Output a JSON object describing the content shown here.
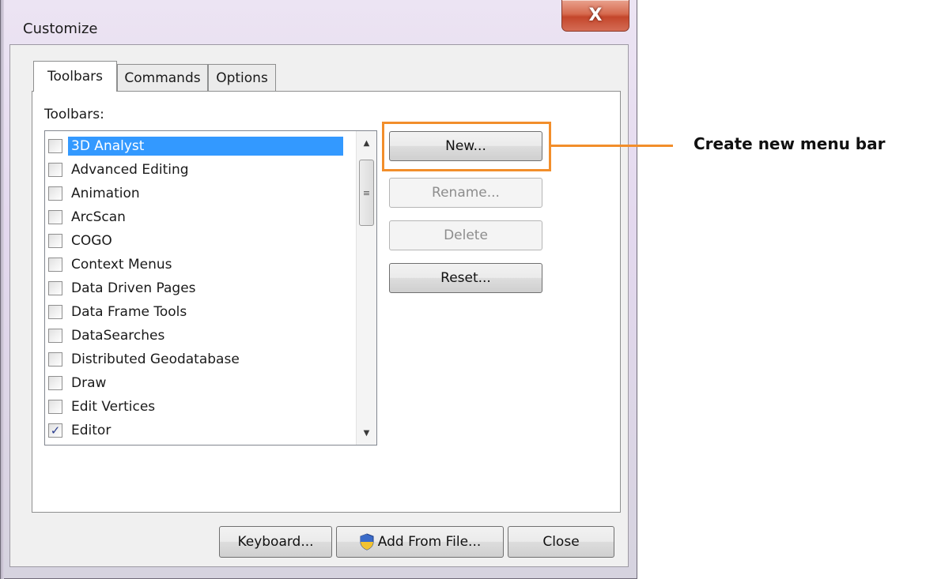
{
  "window": {
    "title": "Customize",
    "close_glyph": "X"
  },
  "tabs": [
    {
      "label": "Toolbars",
      "active": true
    },
    {
      "label": "Commands",
      "active": false
    },
    {
      "label": "Options",
      "active": false
    }
  ],
  "toolbars_panel": {
    "list_label": "Toolbars:",
    "items": [
      {
        "label": "3D Analyst",
        "checked": false,
        "selected": true
      },
      {
        "label": "Advanced Editing",
        "checked": false,
        "selected": false
      },
      {
        "label": "Animation",
        "checked": false,
        "selected": false
      },
      {
        "label": "ArcScan",
        "checked": false,
        "selected": false
      },
      {
        "label": "COGO",
        "checked": false,
        "selected": false
      },
      {
        "label": "Context Menus",
        "checked": false,
        "selected": false
      },
      {
        "label": "Data Driven Pages",
        "checked": false,
        "selected": false
      },
      {
        "label": "Data Frame Tools",
        "checked": false,
        "selected": false
      },
      {
        "label": "DataSearches",
        "checked": false,
        "selected": false
      },
      {
        "label": "Distributed Geodatabase",
        "checked": false,
        "selected": false
      },
      {
        "label": "Draw",
        "checked": false,
        "selected": false
      },
      {
        "label": "Edit Vertices",
        "checked": false,
        "selected": false
      },
      {
        "label": "Editor",
        "checked": true,
        "selected": false
      }
    ],
    "check_glyph": "✓",
    "buttons": {
      "new_label": "New...",
      "rename_label": "Rename...",
      "delete_label": "Delete",
      "reset_label": "Reset..."
    }
  },
  "footer": {
    "keyboard_label": "Keyboard...",
    "add_from_file_label": "Add From File...",
    "close_label": "Close"
  },
  "annotation": {
    "callout_text": "Create new menu bar",
    "color": "#f28e2b"
  },
  "colors": {
    "selection": "#3399ff",
    "disabled_text": "#8d8d8d"
  }
}
